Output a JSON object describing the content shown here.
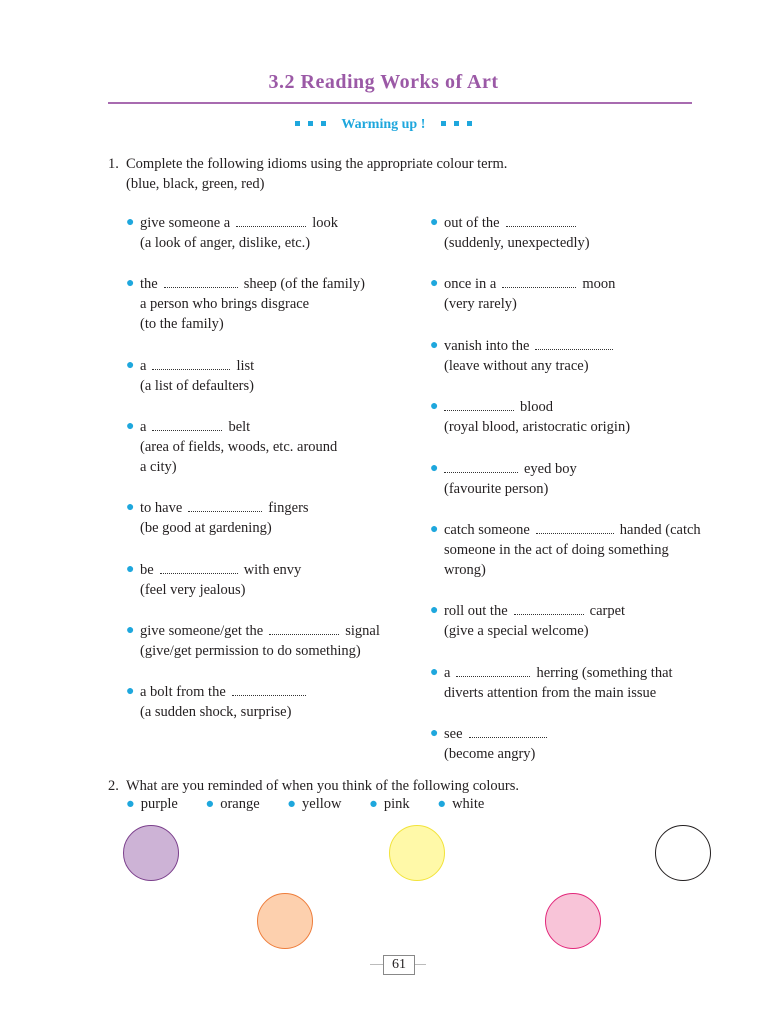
{
  "section_title": "3.2  Reading  Works  of  Art",
  "warming_up": "Warming  up !",
  "q1": {
    "number": "1.",
    "text": "Complete  the  following  idioms  using  the  appropriate  colour  term.",
    "options": "(blue,  black,  green,  red)"
  },
  "left_items": [
    {
      "pre": "give  someone  a",
      "post": "look",
      "gloss": [
        "(a  look  of  anger,  dislike,  etc.)"
      ]
    },
    {
      "pre": "the",
      "post": "sheep  (of  the  family)",
      "gloss": [
        "a  person  who  brings  disgrace",
        "(to  the  family)"
      ]
    },
    {
      "pre": "a",
      "post": "list",
      "gloss": [
        "(a  list  of  defaulters)"
      ]
    },
    {
      "pre": "a",
      "post": "belt",
      "gloss": [
        "(area  of  fields,  woods,  etc.  around",
        "a  city)"
      ]
    },
    {
      "pre": "to  have",
      "post": "fingers",
      "gloss": [
        "(be  good  at  gardening)"
      ]
    },
    {
      "pre": "be",
      "post": "with  envy",
      "gloss": [
        "(feel  very  jealous)"
      ]
    },
    {
      "pre": "give someone/get  the",
      "post": "signal",
      "gloss": [
        "(give/get  permission  to  do  something)"
      ]
    },
    {
      "pre": "a  bolt  from  the",
      "post": "",
      "gloss": [
        "(a  sudden  shock,  surprise)"
      ]
    }
  ],
  "right_items": [
    {
      "pre": "out  of  the",
      "post": "",
      "gloss": [
        "(suddenly,  unexpectedly)"
      ]
    },
    {
      "pre": "once  in  a",
      "post": "moon",
      "gloss": [
        "(very  rarely)"
      ]
    },
    {
      "pre": "vanish  into  the",
      "post": "",
      "gloss": [
        "(leave  without  any  trace)"
      ]
    },
    {
      "pre": "",
      "post": "blood",
      "gloss": [
        "(royal  blood,  aristocratic  origin)"
      ]
    },
    {
      "pre": "",
      "post": "eyed  boy",
      "gloss": [
        "(favourite  person)"
      ]
    },
    {
      "pre": "catch someone",
      "post": "handed (catch",
      "gloss": [
        "someone in the act of doing something",
        "wrong)"
      ]
    },
    {
      "pre": "roll  out  the",
      "post": "carpet",
      "gloss": [
        "(give  a  special  welcome)"
      ]
    },
    {
      "pre": "a",
      "post": "herring  (something  that",
      "gloss": [
        "diverts  attention  from  the  main  issue"
      ]
    },
    {
      "pre": "see",
      "post": "",
      "gloss": [
        "(become  angry)"
      ]
    }
  ],
  "q2": {
    "number": "2.",
    "text": "What  are  you  reminded  of  when  you  think  of  the  following  colours."
  },
  "colours": [
    "purple",
    "orange",
    "yellow",
    "pink",
    "white"
  ],
  "circle_colors": {
    "purple": {
      "fill": "#cdb3d6",
      "stroke": "#7b3f8c"
    },
    "yellow": {
      "fill": "#fff9a8",
      "stroke": "#f2e33a"
    },
    "white": {
      "fill": "#ffffff",
      "stroke": "#231f20"
    },
    "orange": {
      "fill": "#fdd0ae",
      "stroke": "#ee7d3b"
    },
    "pink": {
      "fill": "#f8c4d8",
      "stroke": "#e2277a"
    }
  },
  "page_number": "61"
}
